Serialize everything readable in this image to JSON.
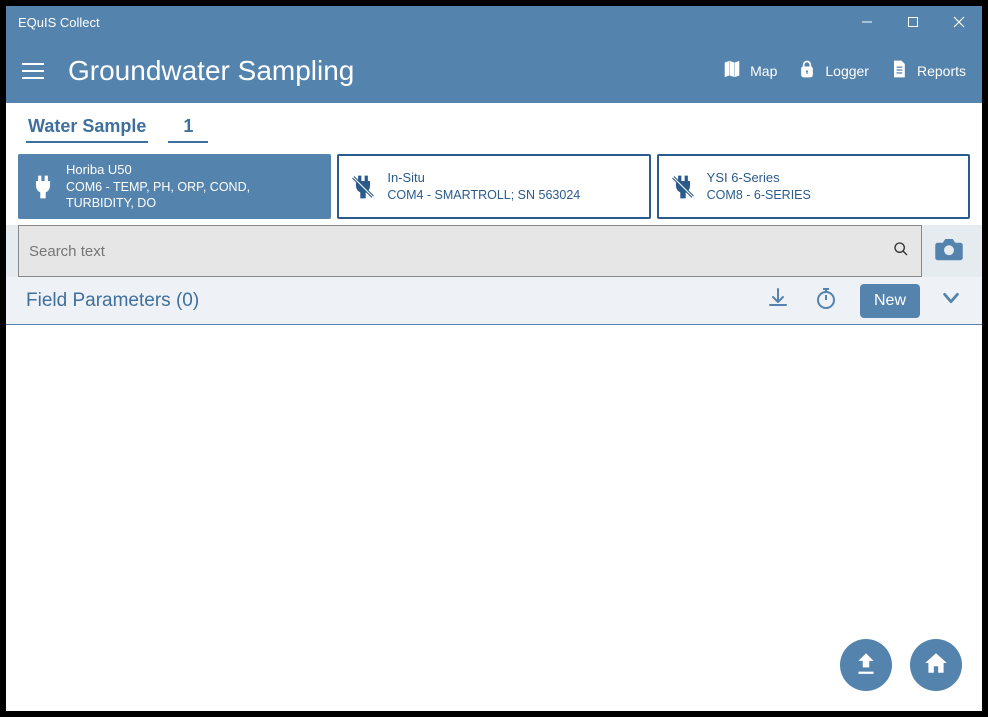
{
  "window": {
    "title": "EQuIS Collect"
  },
  "header": {
    "page_title": "Groundwater Sampling",
    "actions": {
      "map": "Map",
      "logger": "Logger",
      "reports": "Reports"
    }
  },
  "tabs": {
    "water_sample": "Water Sample",
    "count": "1"
  },
  "devices": [
    {
      "name": "Horiba U50",
      "sub": "COM6 - TEMP, PH, ORP, COND, TURBIDITY, DO",
      "active": true,
      "connected": true
    },
    {
      "name": "In-Situ",
      "sub": "COM4 - SMARTROLL; SN 563024",
      "active": false,
      "connected": false
    },
    {
      "name": "YSI 6-Series",
      "sub": "COM8 - 6-SERIES",
      "active": false,
      "connected": false
    }
  ],
  "search": {
    "placeholder": "Search text"
  },
  "section": {
    "title": "Field Parameters (0)",
    "new_label": "New"
  }
}
